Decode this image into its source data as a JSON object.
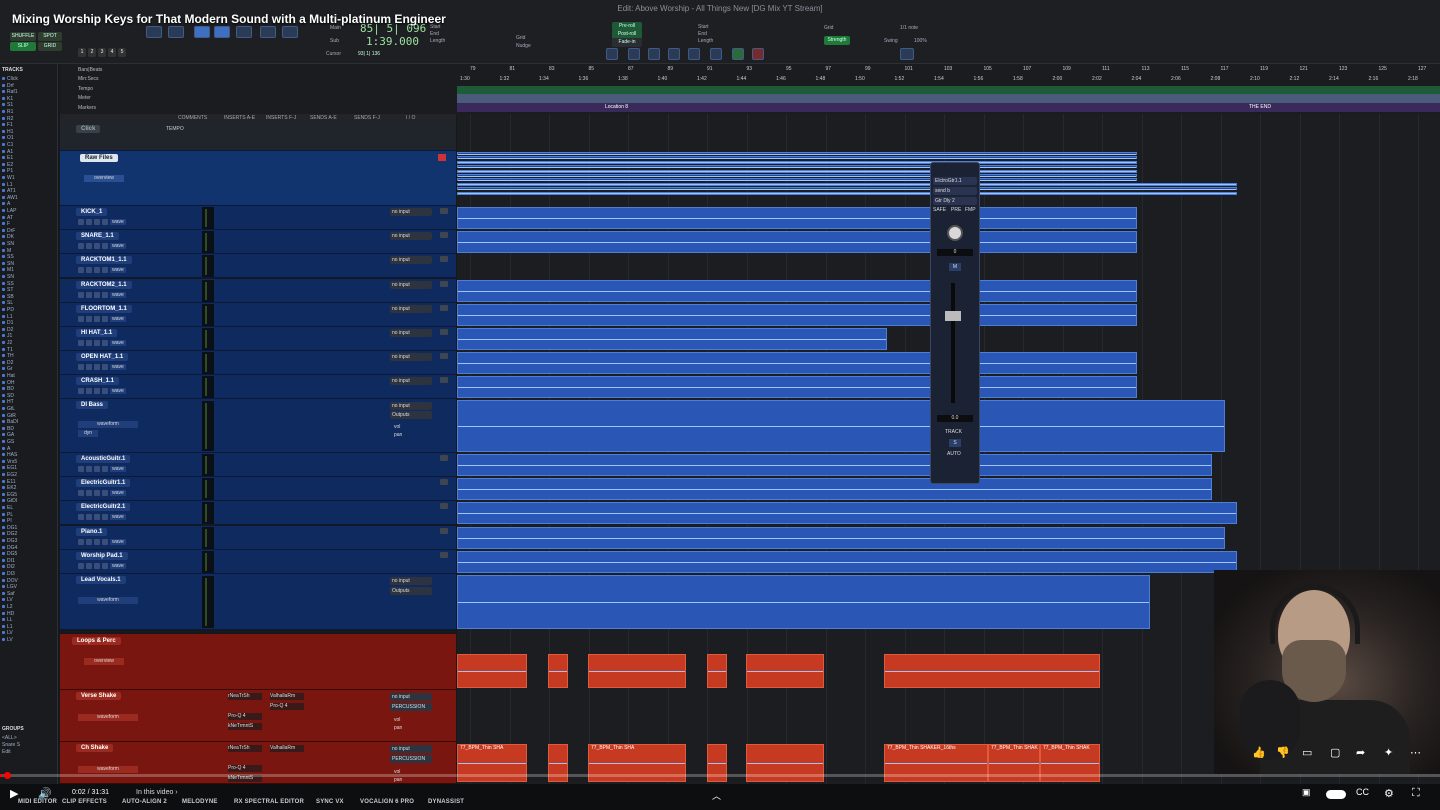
{
  "video": {
    "title": "Mixing Worship Keys for That Modern Sound with a Multi-platinum Engineer",
    "time": "0:02 / 31:31",
    "chapter": "In this video ›",
    "progress": 0.0011
  },
  "window": {
    "title": "Edit: Above Worship - All Things New [DG Mix YT Stream]"
  },
  "topbar": {
    "modes": [
      "SHUFFLE",
      "SPOT",
      "SLIP",
      "GRID"
    ],
    "main_label": "Main",
    "sub_label": "Sub",
    "main_counter": "85| 5| 096",
    "sub_counter": "1:39.000",
    "cursor_label": "Cursor",
    "cursor_value": "93| 1| 136",
    "start_label": "Start",
    "end_label": "End",
    "length_label": "Length",
    "nudge_label": "Nudge",
    "grid_label": "Grid",
    "grid_value": "1/1 note",
    "preroll": "Pre-roll",
    "postroll": "Post-roll",
    "fadein": "Fade-in",
    "strength": "Strength",
    "swing": "Swing",
    "swing_value": "100%",
    "nums": [
      "1",
      "2",
      "3",
      "4",
      "5"
    ]
  },
  "rulers": {
    "names": [
      "Bars|Beats",
      "Min:Secs",
      "Tempo",
      "Meter",
      "Markers"
    ],
    "bars": [
      "79",
      "81",
      "83",
      "85",
      "87",
      "89",
      "91",
      "93",
      "95",
      "97",
      "99",
      "101",
      "103",
      "105",
      "107",
      "109",
      "111",
      "113",
      "115",
      "117",
      "119",
      "121",
      "123",
      "125",
      "127"
    ],
    "times": [
      "1:30",
      "1:32",
      "1:34",
      "1:36",
      "1:38",
      "1:40",
      "1:42",
      "1:44",
      "1:46",
      "1:48",
      "1:50",
      "1:52",
      "1:54",
      "1:56",
      "1:58",
      "2:00",
      "2:02",
      "2:04",
      "2:06",
      "2:08",
      "2:10",
      "2:12",
      "2:14",
      "2:16",
      "2:18"
    ],
    "marker_a": "Location 8",
    "marker_b": "THE END"
  },
  "columns": [
    "COMMENTS",
    "INSERTS A-E",
    "INSERTS F-J",
    "SENDS A-E",
    "SENDS F-J",
    "I / O"
  ],
  "tracks_title": "TRACKS",
  "groups_title": "GROUPS",
  "groups": [
    "<ALL>",
    "Snare S",
    "Edit"
  ],
  "tracklist": [
    "Click",
    "Drf",
    "Raf1",
    "K1",
    "S1",
    "R1",
    "R2",
    "F1",
    "H1",
    "O1",
    "C1",
    "A1",
    "E1",
    "E2",
    "P1",
    "W1",
    "L1",
    "AT1",
    "AW1",
    "A",
    "LAP",
    "AT",
    "F",
    "DrF",
    "DK",
    "SN",
    "M",
    "SS",
    "SN",
    "M1",
    "SN",
    "SS",
    "ST",
    "SB",
    "SL",
    "PD",
    "L1",
    "D1",
    "D2",
    "J1",
    "J2",
    "T1",
    "TH",
    "D2",
    "Gr",
    "Hat",
    "OH",
    "BD",
    "SD",
    "HT",
    "GtL",
    "GtR",
    "BaDI",
    "BD",
    "GA",
    "GS",
    "A",
    "HAS",
    "Vrs5",
    "EG1",
    "EG2",
    "E11",
    "EK2",
    "EG5",
    "GtDI",
    "EL",
    "PL",
    "PI",
    "DG1",
    "DG2",
    "DG3",
    "DG4",
    "DG5",
    "DI1",
    "DI2",
    "DI3",
    "DOV",
    "LGV",
    "Saf",
    "LV",
    "L2",
    "HD",
    "LL",
    "L1",
    "LV",
    "LV"
  ],
  "tempo_track": {
    "name": "Click",
    "label": "TEMPO"
  },
  "folder": {
    "name": "Raw Files",
    "view": "overview"
  },
  "audio_tracks": [
    {
      "name": "KICK_1",
      "view": "wave",
      "io": "no input",
      "out": "Outputs"
    },
    {
      "name": "SNARE_1.1",
      "view": "wave",
      "io": "no input",
      "out": "Outputs"
    },
    {
      "name": "RACKTOM1_1.1",
      "view": "wave",
      "io": "no input",
      "out": "Outputs"
    },
    {
      "name": "RACKTOM2_1.1",
      "view": "wave",
      "io": "no input",
      "out": "Outputs"
    },
    {
      "name": "FLOORTOM_1.1",
      "view": "wave",
      "io": "no input",
      "out": "Outputs"
    },
    {
      "name": "HI HAT_1.1",
      "view": "wave",
      "io": "no input",
      "out": "Outputs"
    },
    {
      "name": "OPEN HAT_1.1",
      "view": "wave",
      "io": "no input",
      "out": "Outputs"
    },
    {
      "name": "CRASH_1.1",
      "view": "wave",
      "io": "no input",
      "out": "Outputs"
    }
  ],
  "di_bass": {
    "name": "DI Bass",
    "view": "waveform",
    "dyn": "dyn",
    "io": "no input",
    "out": "Outputs",
    "vol": "vol",
    "pan": "pan"
  },
  "mid_tracks": [
    {
      "name": "AcousticGuitr.1",
      "view": "wave"
    },
    {
      "name": "ElectricGuitr1.1",
      "view": "wave"
    },
    {
      "name": "ElectricGuitr2.1",
      "view": "wave"
    },
    {
      "name": "Piano.1",
      "view": "wave"
    },
    {
      "name": "Worship Pad.1",
      "view": "wave"
    }
  ],
  "lead": {
    "name": "Lead Vocals.1",
    "view": "waveform",
    "io": "no input",
    "out": "Outputs"
  },
  "loops": {
    "name": "Loops & Perc",
    "view": "overview"
  },
  "shakers": [
    {
      "name": "Verse Shake",
      "view": "waveform",
      "ins": [
        "rNeaTrSh",
        "Pro-Q 4",
        "kNeTrmntS"
      ],
      "ins2": [
        "ValhallaRm",
        "Pro-Q 4"
      ],
      "io": "no input",
      "out": "PERCUSSION",
      "vol": "vol",
      "pan": "pan"
    },
    {
      "name": "Ch Shake",
      "view": "waveform",
      "ins": [
        "rNeaTrSh",
        "Pro-Q 4",
        "kNeTrmntS"
      ],
      "ins2": [
        "ValhallaRm"
      ],
      "io": "no input",
      "out": "PERCUSSION",
      "vol": "vol",
      "pan": "pan"
    }
  ],
  "clip_labels": [
    "77_BPM_Thin SHA",
    "77_BPM_Thin SHAKER_16ths",
    "77_BPM_Thin SHAK"
  ],
  "fader": {
    "name": "ElctroGtr1.1",
    "send": "send b",
    "insert": "Gtr Dly 2",
    "safe": "SAFE",
    "pre": "PRE",
    "fmp": "FMP",
    "value": "0",
    "level": "0.0",
    "track": "TRACK",
    "auto": "AUTO",
    "s": "S",
    "m": "M"
  },
  "plugins": [
    "MIDI EDITOR",
    "CLIP EFFECTS",
    "AUTO-ALIGN 2",
    "MELODYNE",
    "RX SPECTRAL EDITOR",
    "SYNC VX",
    "VOCALIGN 6 PRO",
    "DYNASSIST"
  ],
  "colors": {
    "audio": "#2a57b5",
    "folder_red": "#7a1610",
    "clip_red": "#c73a22",
    "counter": "#9fe39f"
  }
}
